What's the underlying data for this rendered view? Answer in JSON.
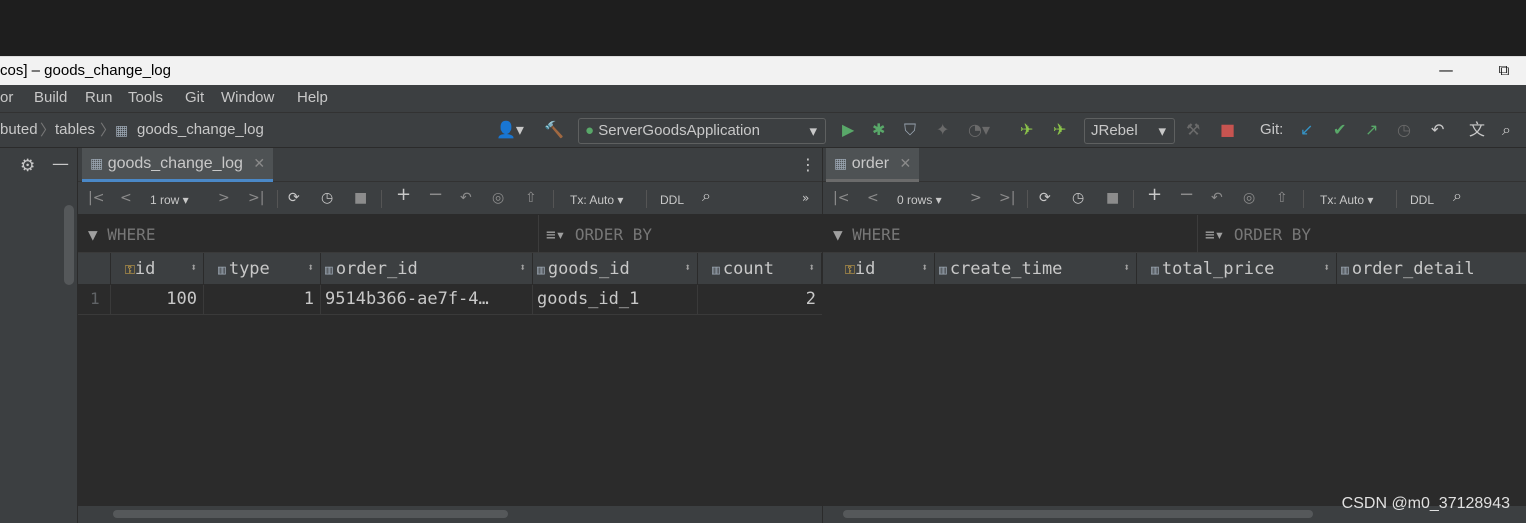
{
  "window": {
    "title": "cos] – goods_change_log",
    "minimize": "—",
    "restore": "⧉"
  },
  "menu": [
    "or",
    "Build",
    "Run",
    "Tools",
    "Git",
    "Window",
    "Help"
  ],
  "breadcrumb": [
    "buted",
    "tables",
    "goods_change_log"
  ],
  "toolbar": {
    "run_config": "ServerGoodsApplication",
    "jrebel": "JRebel",
    "git_label": "Git:"
  },
  "left_pane": {
    "tab": "goods_change_log",
    "rows_label": "1 row",
    "tx_label": "Tx: Auto",
    "ddl_label": "DDL",
    "where": "WHERE",
    "order_by": "ORDER BY",
    "columns": [
      "id",
      "type",
      "order_id",
      "goods_id",
      "count"
    ],
    "rows": [
      {
        "num": "1",
        "id": "100",
        "type": "1",
        "order_id": "9514b366-ae7f-4…",
        "goods_id": "goods_id_1",
        "count": "2"
      }
    ]
  },
  "right_pane": {
    "tab": "order",
    "rows_label": "0 rows",
    "tx_label": "Tx: Auto",
    "ddl_label": "DDL",
    "where": "WHERE",
    "order_by": "ORDER BY",
    "columns": [
      "id",
      "create_time",
      "total_price",
      "order_detail"
    ]
  },
  "watermark": "CSDN @m0_37128943",
  "colors": {
    "run_green": "#59a869",
    "stop_red": "#c75450",
    "git_blue": "#3592c4",
    "accent_tab": "#4a88c7"
  }
}
